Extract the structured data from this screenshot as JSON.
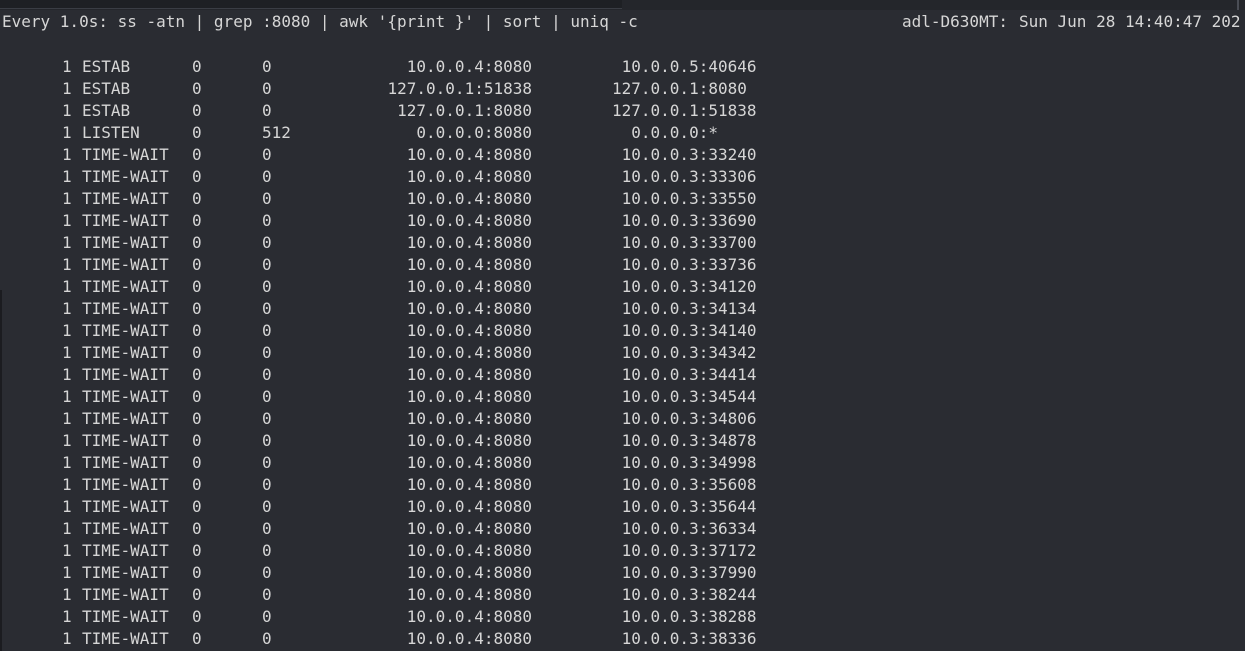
{
  "header": {
    "command": "Every 1.0s: ss -atn | grep :8080 | awk '{print }' | sort | uniq -c",
    "host": "adl-D630MT:",
    "clock": "Sun Jun 28 14:40:47 202"
  },
  "rows": [
    {
      "count": "1",
      "state": "ESTAB",
      "recvq": "0",
      "sendq": "0",
      "local": "10.0.0.4:8080",
      "peer": " 10.0.0.5:40646"
    },
    {
      "count": "1",
      "state": "ESTAB",
      "recvq": "0",
      "sendq": "0",
      "local": "127.0.0.1:51838",
      "peer": "127.0.0.1:8080"
    },
    {
      "count": "1",
      "state": "ESTAB",
      "recvq": "0",
      "sendq": "0",
      "local": "127.0.0.1:8080",
      "peer": "127.0.0.1:51838"
    },
    {
      "count": "1",
      "state": "LISTEN",
      "recvq": "0",
      "sendq": "512",
      "local": "0.0.0.0:8080",
      "peer": "  0.0.0.0:*"
    },
    {
      "count": "1",
      "state": "TIME-WAIT",
      "recvq": "0",
      "sendq": "0",
      "local": "10.0.0.4:8080",
      "peer": " 10.0.0.3:33240"
    },
    {
      "count": "1",
      "state": "TIME-WAIT",
      "recvq": "0",
      "sendq": "0",
      "local": "10.0.0.4:8080",
      "peer": " 10.0.0.3:33306"
    },
    {
      "count": "1",
      "state": "TIME-WAIT",
      "recvq": "0",
      "sendq": "0",
      "local": "10.0.0.4:8080",
      "peer": " 10.0.0.3:33550"
    },
    {
      "count": "1",
      "state": "TIME-WAIT",
      "recvq": "0",
      "sendq": "0",
      "local": "10.0.0.4:8080",
      "peer": " 10.0.0.3:33690"
    },
    {
      "count": "1",
      "state": "TIME-WAIT",
      "recvq": "0",
      "sendq": "0",
      "local": "10.0.0.4:8080",
      "peer": " 10.0.0.3:33700"
    },
    {
      "count": "1",
      "state": "TIME-WAIT",
      "recvq": "0",
      "sendq": "0",
      "local": "10.0.0.4:8080",
      "peer": " 10.0.0.3:33736"
    },
    {
      "count": "1",
      "state": "TIME-WAIT",
      "recvq": "0",
      "sendq": "0",
      "local": "10.0.0.4:8080",
      "peer": " 10.0.0.3:34120"
    },
    {
      "count": "1",
      "state": "TIME-WAIT",
      "recvq": "0",
      "sendq": "0",
      "local": "10.0.0.4:8080",
      "peer": " 10.0.0.3:34134"
    },
    {
      "count": "1",
      "state": "TIME-WAIT",
      "recvq": "0",
      "sendq": "0",
      "local": "10.0.0.4:8080",
      "peer": " 10.0.0.3:34140"
    },
    {
      "count": "1",
      "state": "TIME-WAIT",
      "recvq": "0",
      "sendq": "0",
      "local": "10.0.0.4:8080",
      "peer": " 10.0.0.3:34342"
    },
    {
      "count": "1",
      "state": "TIME-WAIT",
      "recvq": "0",
      "sendq": "0",
      "local": "10.0.0.4:8080",
      "peer": " 10.0.0.3:34414"
    },
    {
      "count": "1",
      "state": "TIME-WAIT",
      "recvq": "0",
      "sendq": "0",
      "local": "10.0.0.4:8080",
      "peer": " 10.0.0.3:34544"
    },
    {
      "count": "1",
      "state": "TIME-WAIT",
      "recvq": "0",
      "sendq": "0",
      "local": "10.0.0.4:8080",
      "peer": " 10.0.0.3:34806"
    },
    {
      "count": "1",
      "state": "TIME-WAIT",
      "recvq": "0",
      "sendq": "0",
      "local": "10.0.0.4:8080",
      "peer": " 10.0.0.3:34878"
    },
    {
      "count": "1",
      "state": "TIME-WAIT",
      "recvq": "0",
      "sendq": "0",
      "local": "10.0.0.4:8080",
      "peer": " 10.0.0.3:34998"
    },
    {
      "count": "1",
      "state": "TIME-WAIT",
      "recvq": "0",
      "sendq": "0",
      "local": "10.0.0.4:8080",
      "peer": " 10.0.0.3:35608"
    },
    {
      "count": "1",
      "state": "TIME-WAIT",
      "recvq": "0",
      "sendq": "0",
      "local": "10.0.0.4:8080",
      "peer": " 10.0.0.3:35644"
    },
    {
      "count": "1",
      "state": "TIME-WAIT",
      "recvq": "0",
      "sendq": "0",
      "local": "10.0.0.4:8080",
      "peer": " 10.0.0.3:36334"
    },
    {
      "count": "1",
      "state": "TIME-WAIT",
      "recvq": "0",
      "sendq": "0",
      "local": "10.0.0.4:8080",
      "peer": " 10.0.0.3:37172"
    },
    {
      "count": "1",
      "state": "TIME-WAIT",
      "recvq": "0",
      "sendq": "0",
      "local": "10.0.0.4:8080",
      "peer": " 10.0.0.3:37990"
    },
    {
      "count": "1",
      "state": "TIME-WAIT",
      "recvq": "0",
      "sendq": "0",
      "local": "10.0.0.4:8080",
      "peer": " 10.0.0.3:38244"
    },
    {
      "count": "1",
      "state": "TIME-WAIT",
      "recvq": "0",
      "sendq": "0",
      "local": "10.0.0.4:8080",
      "peer": " 10.0.0.3:38288"
    },
    {
      "count": "1",
      "state": "TIME-WAIT",
      "recvq": "0",
      "sendq": "0",
      "local": "10.0.0.4:8080",
      "peer": " 10.0.0.3:38336"
    }
  ]
}
